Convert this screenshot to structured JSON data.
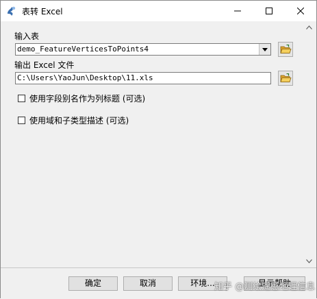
{
  "window": {
    "title": "表转 Excel",
    "icon": "arcgis-tool-icon"
  },
  "form": {
    "input_table": {
      "label": "输入表",
      "value": "demo_FeatureVerticesToPoints4"
    },
    "output_excel": {
      "label": "输出 Excel 文件",
      "value": "C:\\Users\\YaoJun\\Desktop\\11.xls"
    },
    "checkbox_alias": {
      "label": "使用字段别名作为列标题 (可选)",
      "checked": false
    },
    "checkbox_domain": {
      "label": "使用域和子类型描述 (可选)",
      "checked": false
    }
  },
  "footer": {
    "ok_label": "确定",
    "cancel_label": "取消",
    "env_label": "环境...",
    "help_label": "显示帮助"
  },
  "watermark": {
    "text": "知乎 @测绘遥感地理信息"
  },
  "colors": {
    "titlebar": "#ffffff",
    "dialog": "#f0f0f0",
    "button": "#e1e1e1",
    "folder": "#e8b83a"
  }
}
